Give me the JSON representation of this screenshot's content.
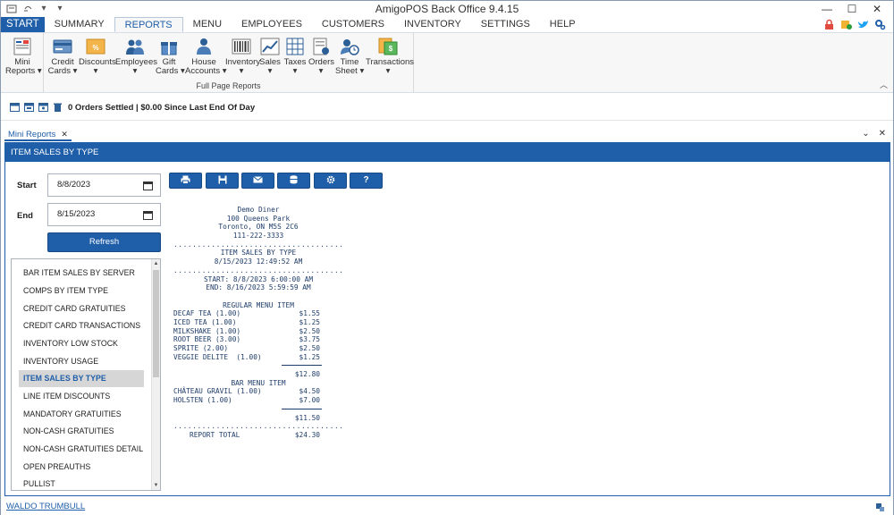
{
  "window": {
    "title": "AmigoPOS Back Office 9.4.15"
  },
  "tabs": [
    {
      "label": "START"
    },
    {
      "label": "SUMMARY"
    },
    {
      "label": "REPORTS"
    },
    {
      "label": "MENU"
    },
    {
      "label": "EMPLOYEES"
    },
    {
      "label": "CUSTOMERS"
    },
    {
      "label": "INVENTORY"
    },
    {
      "label": "SETTINGS"
    },
    {
      "label": "HELP"
    }
  ],
  "ribbon": {
    "buttons": [
      {
        "label1": "Mini",
        "label2": "Reports",
        "icon": "mini-reports-icon"
      },
      {
        "label1": "Credit",
        "label2": "Cards",
        "icon": "credit-card-icon"
      },
      {
        "label1": "Discounts",
        "label2": "",
        "icon": "discount-icon"
      },
      {
        "label1": "Employees",
        "label2": "",
        "icon": "employees-icon"
      },
      {
        "label1": "Gift",
        "label2": "Cards",
        "icon": "gift-icon"
      },
      {
        "label1": "House",
        "label2": "Accounts",
        "icon": "house-accounts-icon"
      },
      {
        "label1": "Inventory",
        "label2": "",
        "icon": "barcode-icon"
      },
      {
        "label1": "Sales",
        "label2": "",
        "icon": "sales-chart-icon"
      },
      {
        "label1": "Taxes",
        "label2": "",
        "icon": "taxes-icon"
      },
      {
        "label1": "Orders",
        "label2": "",
        "icon": "orders-icon"
      },
      {
        "label1": "Time",
        "label2": "Sheet",
        "icon": "timesheet-icon"
      },
      {
        "label1": "Transactions",
        "label2": "",
        "icon": "transactions-icon"
      }
    ],
    "group_label": "Full Page Reports"
  },
  "status": {
    "text": "0 Orders Settled | $0.00 Since Last End Of Day"
  },
  "doc_tab": {
    "label": "Mini Reports"
  },
  "panel": {
    "title": "ITEM SALES BY TYPE",
    "start_label": "Start",
    "start_value": "8/8/2023",
    "end_label": "End",
    "end_value": "8/15/2023",
    "refresh_label": "Refresh"
  },
  "reports": [
    "BAR ITEM SALES BY SERVER",
    "COMPS BY ITEM TYPE",
    "CREDIT CARD GRATUITIES",
    "CREDIT CARD TRANSACTIONS",
    "INVENTORY LOW STOCK",
    "INVENTORY USAGE",
    "ITEM SALES BY TYPE",
    "LINE ITEM DISCOUNTS",
    "MANDATORY GRATUITIES",
    "NON-CASH GRATUITIES",
    "NON-CASH GRATUITIES DETAIL",
    "OPEN PREAUTHS",
    "PULLIST"
  ],
  "selected_report_index": 6,
  "toolbar": {
    "buttons": [
      {
        "icon": "print-icon"
      },
      {
        "icon": "save-icon"
      },
      {
        "icon": "email-icon"
      },
      {
        "icon": "database-icon"
      },
      {
        "icon": "gear-icon"
      },
      {
        "icon": "help-icon",
        "label": "?"
      }
    ]
  },
  "receipt": {
    "header": [
      "Demo Diner",
      "100 Queens Park",
      "Toronto, ON M5S 2C6",
      "111-222-3333"
    ],
    "dots": "....................................",
    "report_title": "ITEM SALES BY TYPE",
    "report_timestamp": "8/15/2023 12:49:52 AM",
    "start_line": "START: 8/8/2023 6:00:00 AM",
    "end_line": "END: 8/16/2023 5:59:59 AM",
    "sections": [
      {
        "name": "REGULAR MENU ITEM",
        "items": [
          {
            "name": "DECAF TEA (1.00)",
            "amount": "$1.55"
          },
          {
            "name": "ICED TEA (1.00)",
            "amount": "$1.25"
          },
          {
            "name": "MILKSHAKE (1.00)",
            "amount": "$2.50"
          },
          {
            "name": "ROOT BEER (3.00)",
            "amount": "$3.75"
          },
          {
            "name": "SPRITE (2.00)",
            "amount": "$2.50"
          },
          {
            "name": "VEGGIE DELITE  (1.00)",
            "amount": "$1.25"
          }
        ],
        "subtotal": "$12.80"
      },
      {
        "name": "BAR MENU ITEM",
        "items": [
          {
            "name": "CHÂTEAU GRAVIL (1.00)",
            "amount": "$4.50"
          },
          {
            "name": "HOLSTEN (1.00)",
            "amount": "$7.00"
          }
        ],
        "subtotal": "$11.50"
      }
    ],
    "total_label": "REPORT TOTAL",
    "total_amount": "$24.30"
  },
  "footer": {
    "user": "WALDO TRUMBULL"
  }
}
